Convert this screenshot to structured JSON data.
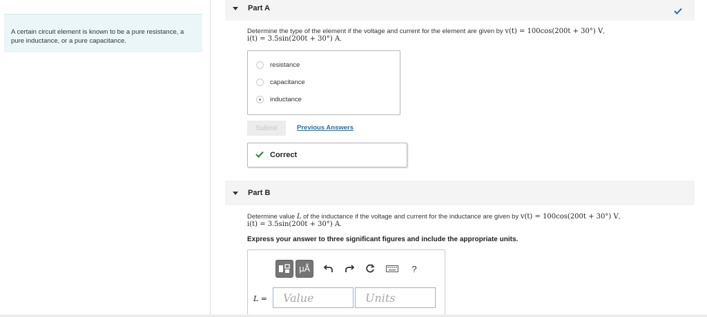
{
  "intro": {
    "text": "A certain circuit element is known to be a pure resistance, a pure inductance, or a pure capacitance."
  },
  "part_a": {
    "title": "Part A",
    "question": {
      "text1": "Determine the type of the element if the voltage and current for the element are given by ",
      "v_eq": "v(t) = 100cos(200t + 30°) V",
      "sep": ",",
      "i_eq": "i(t) = 3.5sin(200t + 30°) A",
      "end": "."
    },
    "choices": [
      {
        "label": "resistance",
        "selected": false
      },
      {
        "label": "capacitance",
        "selected": false
      },
      {
        "label": "inductance",
        "selected": true
      }
    ],
    "submit_label": "Submit",
    "previous_answers_label": "Previous Answers",
    "feedback_label": "Correct",
    "status": "correct"
  },
  "part_b": {
    "title": "Part B",
    "question": {
      "text1": "Determine value ",
      "var": "L",
      "text2": " of the inductance if the voltage and current for the inductance are given by ",
      "v_eq": "v(t) = 100cos(200t + 30°) V",
      "sep": ",",
      "i_eq": "i(t) = 3.5sin(200t + 30°) A",
      "end": "."
    },
    "instructions": "Express your answer to three significant figures and include the appropriate units.",
    "toolbar": {
      "units_button": "μÅ",
      "help": "?"
    },
    "equation_label": "L =",
    "value_placeholder": "Value",
    "units_placeholder": "Units"
  },
  "colors": {
    "accent": "#2a6ca0",
    "correct_green": "#2e8b3a",
    "intro_bg": "#eaf6f8"
  },
  "icons": [
    "caret-down-icon",
    "checkmark-icon",
    "templates-icon",
    "units-icon",
    "undo-icon",
    "redo-icon",
    "reset-icon",
    "keyboard-icon",
    "help-icon"
  ]
}
